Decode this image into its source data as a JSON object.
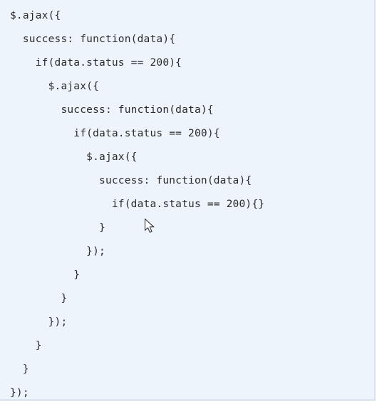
{
  "code_lines": [
    "$.ajax({",
    "  success: function(data){",
    "    if(data.status == 200){",
    "      $.ajax({",
    "        success: function(data){",
    "          if(data.status == 200){",
    "            $.ajax({",
    "              success: function(data){",
    "                if(data.status == 200){}",
    "              }",
    "            });",
    "          }",
    "        }",
    "      });",
    "    }",
    "  }",
    "});"
  ]
}
